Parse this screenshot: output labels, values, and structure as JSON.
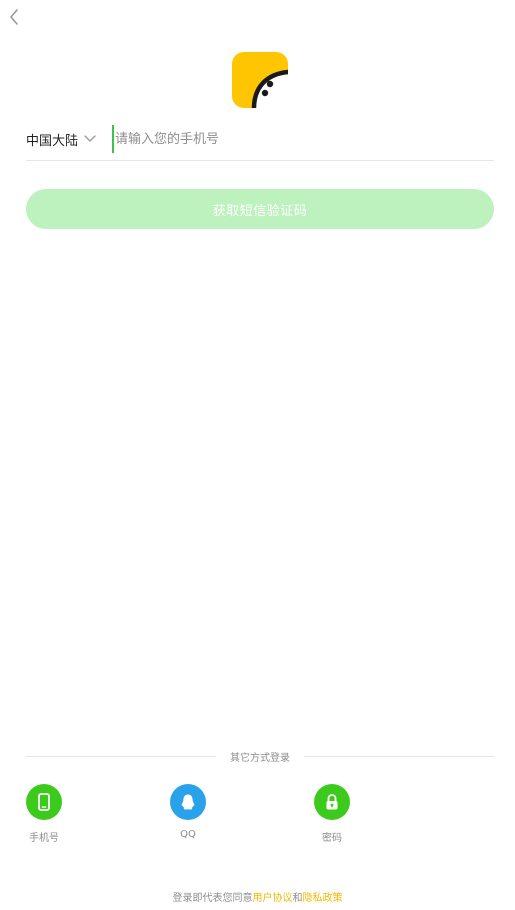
{
  "header": {
    "back_icon": "chevron-left-icon"
  },
  "logo": {
    "icon": "app-logo-face",
    "bg_color": "#ffc500"
  },
  "phone_form": {
    "region_label": "中国大陆",
    "region_icon": "chevron-down-icon",
    "phone_placeholder": "请输入您的手机号",
    "phone_value": "",
    "cursor_color": "#3bc44b"
  },
  "sms_button": {
    "label": "获取短信验证码",
    "bg_color": "#bdf1be"
  },
  "other_login": {
    "title": "其它方式登录",
    "options": [
      {
        "label": "手机号",
        "icon": "phone-icon",
        "color": "#3ccb1d"
      },
      {
        "label": "QQ",
        "icon": "qq-penguin-icon",
        "color": "#2aa2ea"
      },
      {
        "label": "密码",
        "icon": "lock-icon",
        "color": "#3ccb1d"
      }
    ]
  },
  "agreement": {
    "prefix": "登录即代表您同意",
    "user_agreement": "用户协议",
    "conjunction": "和",
    "privacy_policy": "隐私政策",
    "link_color": "#f5b800"
  }
}
